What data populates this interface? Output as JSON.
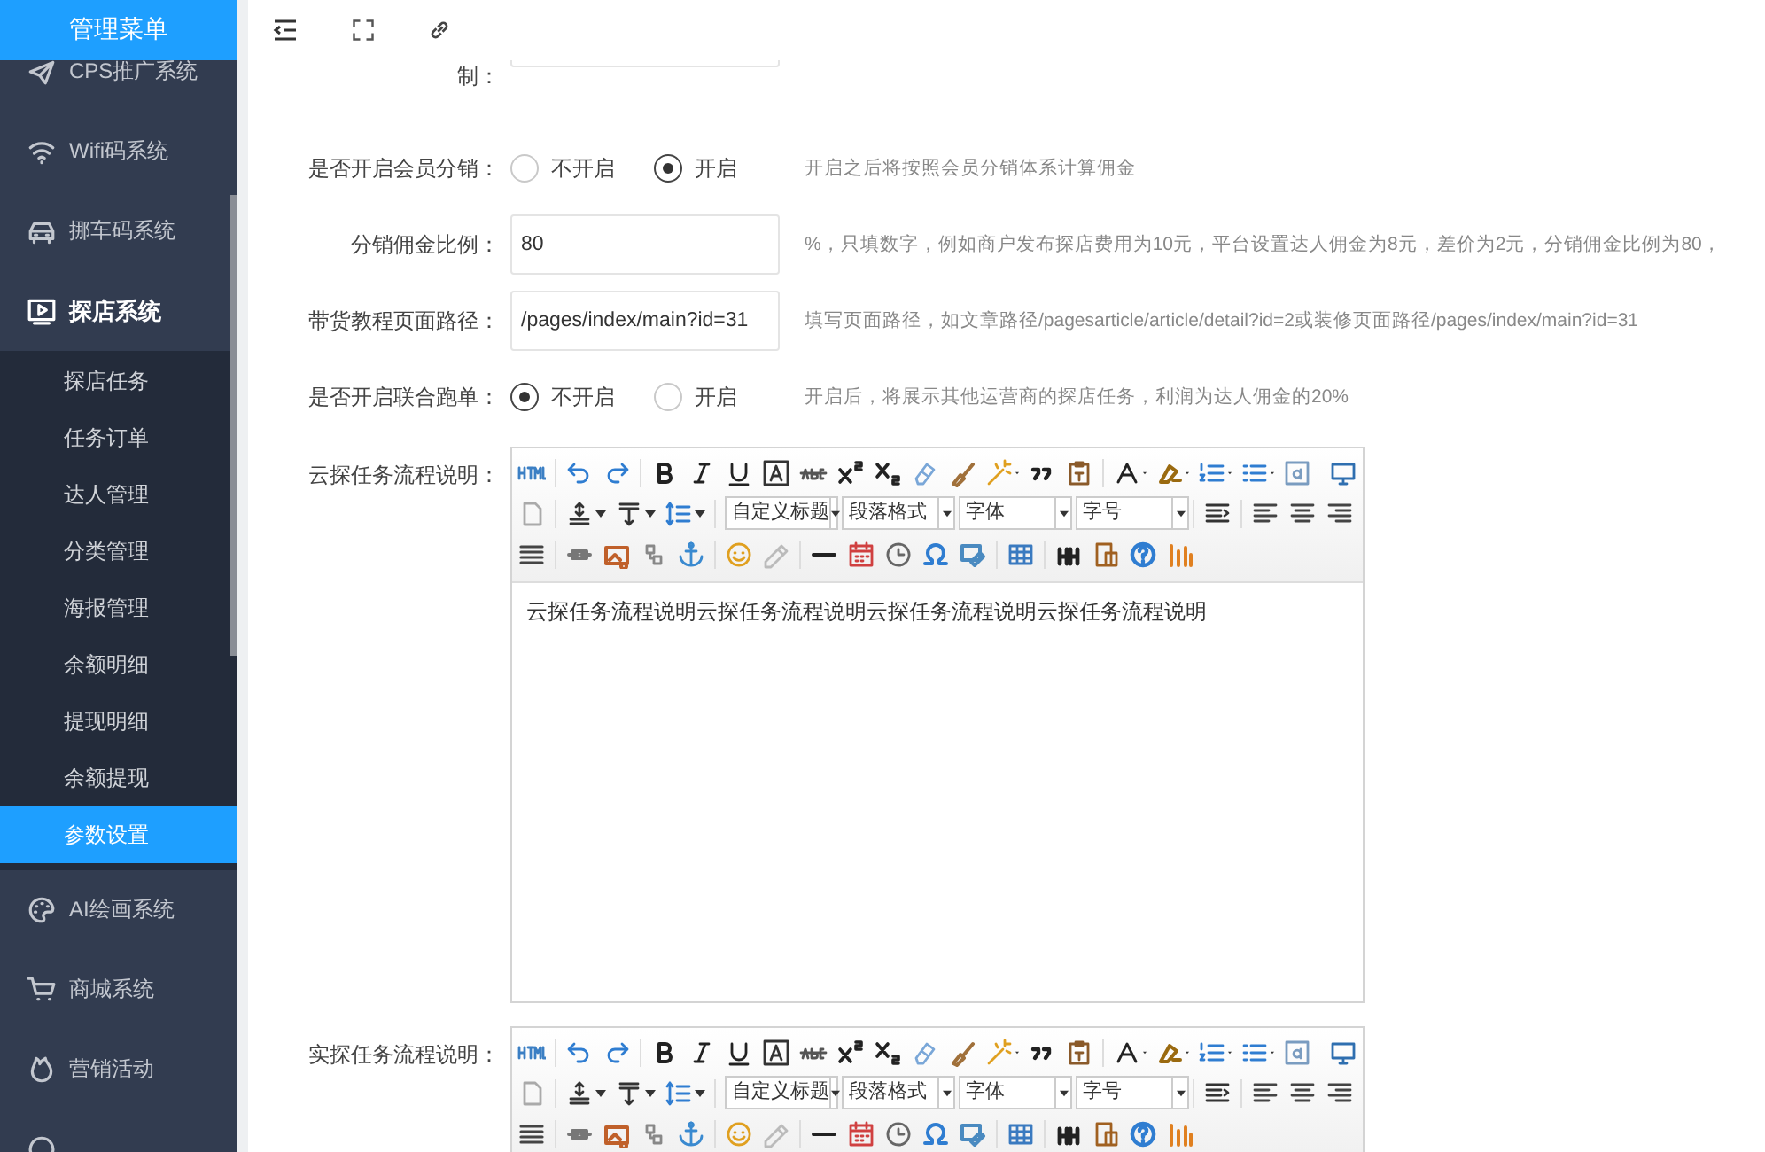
{
  "header": {
    "title": "管理菜单"
  },
  "sidebar": {
    "items": [
      {
        "label": "CPS推广系统",
        "expanded": false
      },
      {
        "label": "Wifi码系统",
        "expanded": false
      },
      {
        "label": "挪车码系统",
        "expanded": false
      },
      {
        "label": "探店系统",
        "expanded": true,
        "children": [
          {
            "label": "探店任务",
            "selected": false
          },
          {
            "label": "任务订单",
            "selected": false
          },
          {
            "label": "达人管理",
            "selected": false
          },
          {
            "label": "分类管理",
            "selected": false
          },
          {
            "label": "海报管理",
            "selected": false
          },
          {
            "label": "余额明细",
            "selected": false
          },
          {
            "label": "提现明细",
            "selected": false
          },
          {
            "label": "余额提现",
            "selected": false
          },
          {
            "label": "参数设置",
            "selected": true
          }
        ]
      },
      {
        "label": "AI绘画系统",
        "expanded": false
      },
      {
        "label": "商城系统",
        "expanded": false
      },
      {
        "label": "营销活动",
        "expanded": false
      },
      {
        "expanded": false
      }
    ]
  },
  "form": {
    "rows": [
      {
        "kind": "input",
        "label": "制："
      },
      {
        "kind": "radio",
        "label": "是否开启会员分销：",
        "options": [
          {
            "label": "不开启",
            "selected": false
          },
          {
            "label": "开启",
            "selected": true
          }
        ],
        "hint": "开启之后将按照会员分销体系计算佣金"
      },
      {
        "kind": "input",
        "label": "分销佣金比例：",
        "value": "80",
        "hint": "%，只填数字，例如商户发布探店费用为10元，平台设置达人佣金为8元，差价为2元，分销佣金比例为80，"
      },
      {
        "kind": "input",
        "label": "带货教程页面路径：",
        "value": "/pages/index/main?id=31",
        "hint": "填写页面路径，如文章路径/pagesarticle/article/detail?id=2或装修页面路径/pages/index/main?id=31"
      },
      {
        "kind": "radio",
        "label": "是否开启联合跑单：",
        "options": [
          {
            "label": "不开启",
            "selected": true
          },
          {
            "label": "开启",
            "selected": false
          }
        ],
        "hint": "开启后，将展示其他运营商的探店任务，利润为达人佣金的20%"
      },
      {
        "kind": "editor",
        "label": "云探任务流程说明：",
        "selects": [
          "自定义标题",
          "段落格式",
          "字体",
          "字号"
        ],
        "content": "云探任务流程说明云探任务流程说明云探任务流程说明云探任务流程说明"
      },
      {
        "kind": "editor",
        "label": "实探任务流程说明：",
        "selects": [
          "自定义标题",
          "段落格式",
          "字体",
          "字号"
        ]
      }
    ]
  }
}
